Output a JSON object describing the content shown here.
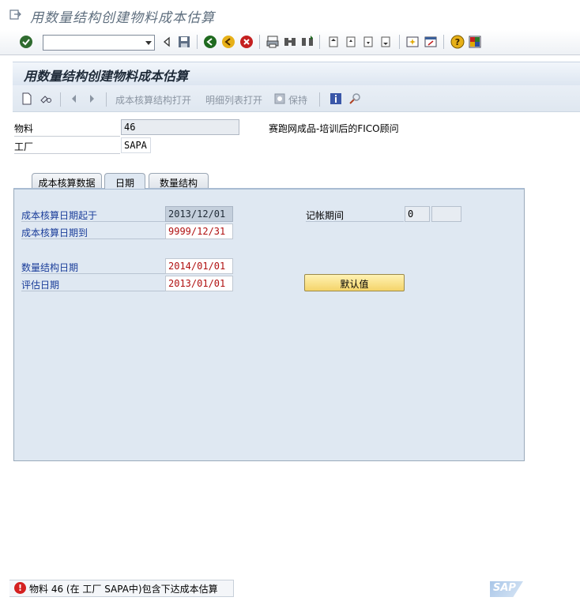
{
  "window": {
    "title": "用数量结构创建物料成本估算"
  },
  "system_toolbar": {
    "command_value": "",
    "icons": [
      "enter-icon",
      "back-icon",
      "save-icon",
      "green-back-icon",
      "exit-icon",
      "cancel-icon",
      "print-icon",
      "find-icon",
      "find-next-icon",
      "first-page-icon",
      "previous-page-icon",
      "next-page-icon",
      "last-page-icon",
      "new-session-icon",
      "shortcut-icon",
      "help-icon",
      "layout-menu-icon"
    ]
  },
  "screen": {
    "title": "用数量结构创建物料成本估算"
  },
  "app_toolbar": {
    "costing_structure_open": "成本核算结构打开",
    "itemization_open": "明细列表打开",
    "save": "保持"
  },
  "header": {
    "material_label": "物料",
    "material_value": "46",
    "material_description": "赛跑网成品-培训后的FICO顾问",
    "plant_label": "工厂",
    "plant_value": "SAPA"
  },
  "tabs": [
    {
      "label": "成本核算数据",
      "active": false
    },
    {
      "label": "日期",
      "active": true
    },
    {
      "label": "数量结构",
      "active": false
    }
  ],
  "dates": {
    "costing_date_from_label": "成本核算日期起于",
    "costing_date_from": "2013/12/01",
    "costing_date_to_label": "成本核算日期到",
    "costing_date_to": "9999/12/31",
    "qty_structure_date_label": "数量结构日期",
    "qty_structure_date": "2014/01/01",
    "valuation_date_label": "评估日期",
    "valuation_date": "2013/01/01",
    "posting_period_label": "记帐期间",
    "posting_period": "0",
    "posting_year": "",
    "default_button": "默认值"
  },
  "status": {
    "type": "error",
    "message": "物料 46 (在 工厂 SAPA中)包含下达成本估算"
  },
  "colors": {
    "panel_bg": "#dfe8f2",
    "required_label": "#1a3d9a",
    "date_text": "#b01010",
    "default_button": "#f4d46a",
    "status_error": "#d42020"
  }
}
